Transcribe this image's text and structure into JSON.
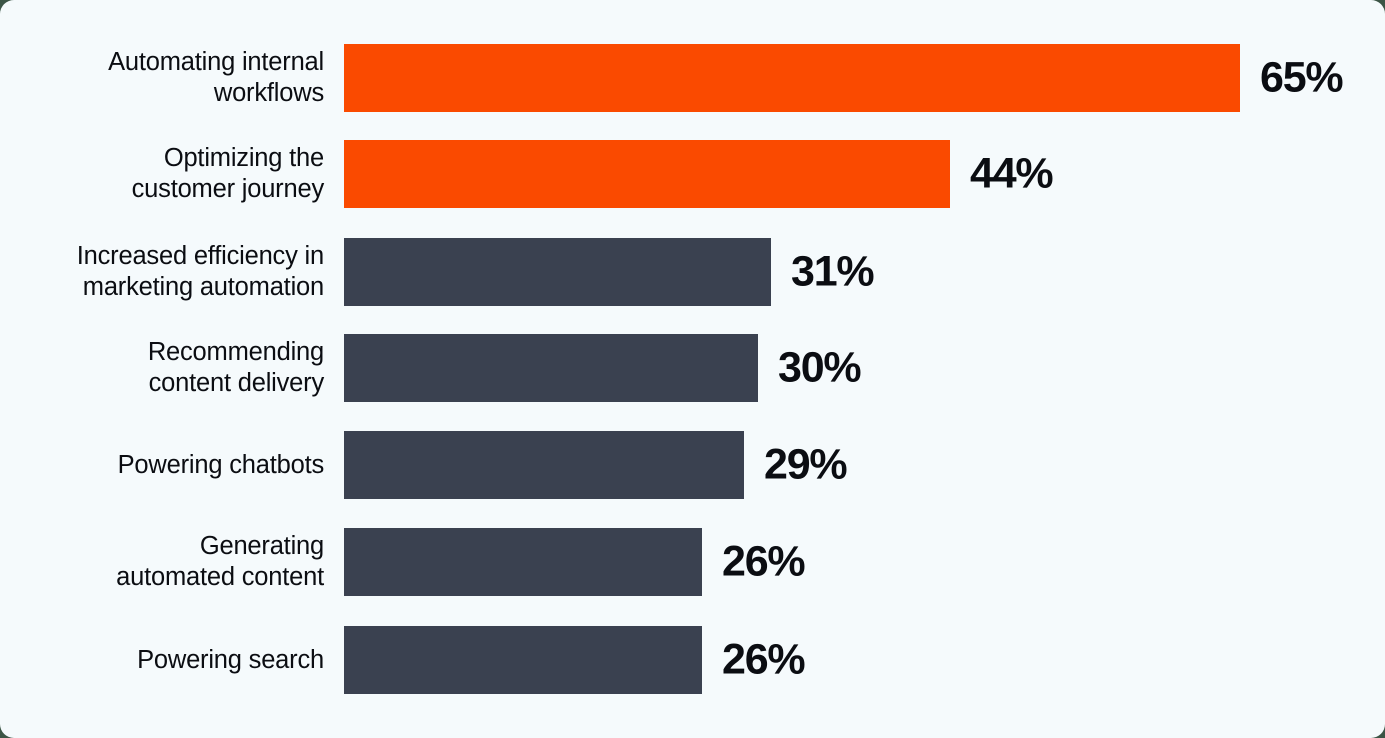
{
  "chart_data": {
    "type": "bar",
    "orientation": "horizontal",
    "title": "",
    "subtitle": "",
    "xlabel": "",
    "ylabel": "",
    "xlim": [
      0,
      65
    ],
    "grid": false,
    "legend": null,
    "value_suffix": "%",
    "categories": [
      "Automating internal\nworkflows",
      "Optimizing the\ncustomer journey",
      "Increased efficiency in\nmarketing automation",
      "Recommending\ncontent delivery",
      "Powering chatbots",
      "Generating\nautomated content",
      "Powering search"
    ],
    "values": [
      65,
      44,
      31,
      30,
      29,
      26,
      26
    ],
    "value_labels": [
      "65%",
      "44%",
      "31%",
      "30%",
      "29%",
      "26%",
      "26%"
    ],
    "bar_colors": [
      "#fa4a00",
      "#fa4a00",
      "#3a4150",
      "#3a4150",
      "#3a4150",
      "#3a4150",
      "#3a4150"
    ]
  },
  "colors": {
    "background": "#f5fafc",
    "page_surround": "#3c5546",
    "accent_orange": "#fa4a00",
    "bar_dark": "#3a4150",
    "text": "#0b0d12"
  }
}
